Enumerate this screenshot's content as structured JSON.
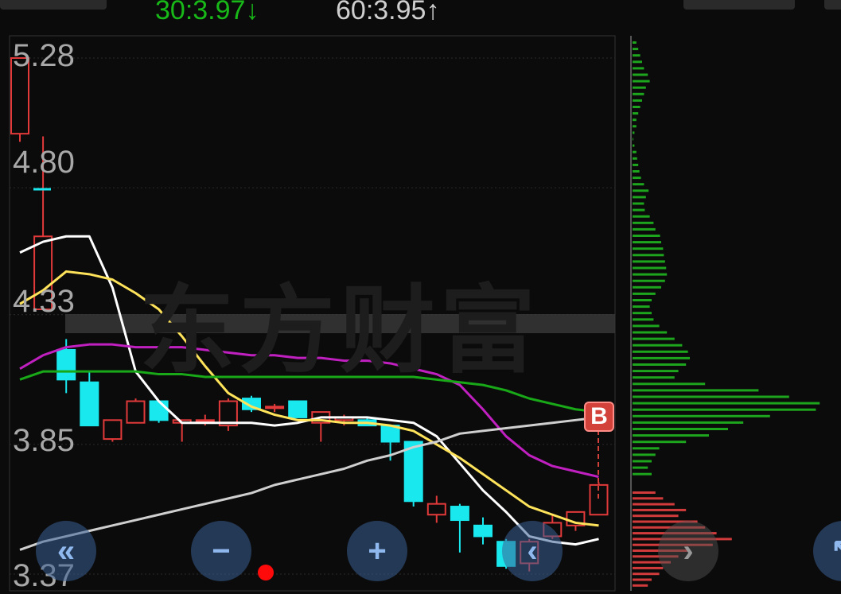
{
  "header": {
    "ma30": "30:3.97",
    "ma30_arrow": "↓",
    "ma60": "60:3.95",
    "ma60_arrow": "↑"
  },
  "watermark": "东方财富",
  "y_axis": {
    "labels": [
      "5.28",
      "4.80",
      "4.33",
      "3.85",
      "3.37"
    ],
    "values": [
      5.28,
      4.8,
      4.33,
      3.85,
      3.37
    ]
  },
  "badge": {
    "label": "B"
  },
  "controls": {
    "back": "«",
    "zoom_out": "−",
    "zoom_in": "+",
    "prev": "‹",
    "next": "›",
    "expand": "↖"
  },
  "colors": {
    "up": "#e23a3a",
    "down": "#19e8ee",
    "ma5": "#ffffff",
    "ma10": "#ffe35a",
    "ma20": "#c020c0",
    "ma30": "#18a818",
    "ma60": "#cfcfcf",
    "profile_up": "#d23b3b",
    "profile_down": "#1ea51e"
  },
  "chart_data": {
    "type": "candlestick",
    "ylim": [
      3.37,
      5.28
    ],
    "candles": [
      {
        "o": 5.0,
        "h": 5.28,
        "l": 4.97,
        "c": 5.28
      },
      {
        "o": 4.35,
        "h": 4.99,
        "l": 4.35,
        "c": 4.62
      },
      {
        "o": 4.2,
        "h": 4.24,
        "l": 4.04,
        "c": 4.09
      },
      {
        "o": 4.08,
        "h": 4.12,
        "l": 3.92,
        "c": 3.92
      },
      {
        "o": 3.87,
        "h": 3.94,
        "l": 3.86,
        "c": 3.94
      },
      {
        "o": 3.93,
        "h": 4.02,
        "l": 3.93,
        "c": 4.01
      },
      {
        "o": 4.01,
        "h": 4.01,
        "l": 3.93,
        "c": 3.94
      },
      {
        "o": 3.93,
        "h": 3.94,
        "l": 3.86,
        "c": 3.94
      },
      {
        "o": 3.94,
        "h": 3.96,
        "l": 3.92,
        "c": 3.94
      },
      {
        "o": 3.92,
        "h": 4.02,
        "l": 3.9,
        "c": 4.01
      },
      {
        "o": 4.02,
        "h": 4.03,
        "l": 3.97,
        "c": 3.98
      },
      {
        "o": 3.99,
        "h": 4.0,
        "l": 3.97,
        "c": 3.99
      },
      {
        "o": 4.01,
        "h": 4.01,
        "l": 3.95,
        "c": 3.95
      },
      {
        "o": 3.93,
        "h": 3.97,
        "l": 3.86,
        "c": 3.97
      },
      {
        "o": 3.94,
        "h": 3.96,
        "l": 3.92,
        "c": 3.95
      },
      {
        "o": 3.94,
        "h": 3.95,
        "l": 3.92,
        "c": 3.92
      },
      {
        "o": 3.92,
        "h": 3.92,
        "l": 3.79,
        "c": 3.86
      },
      {
        "o": 3.86,
        "h": 3.86,
        "l": 3.62,
        "c": 3.64
      },
      {
        "o": 3.59,
        "h": 3.66,
        "l": 3.56,
        "c": 3.63
      },
      {
        "o": 3.62,
        "h": 3.63,
        "l": 3.45,
        "c": 3.57
      },
      {
        "o": 3.55,
        "h": 3.58,
        "l": 3.48,
        "c": 3.51
      },
      {
        "o": 3.49,
        "h": 3.5,
        "l": 3.39,
        "c": 3.4
      },
      {
        "o": 3.41,
        "h": 3.5,
        "l": 3.38,
        "c": 3.49
      },
      {
        "o": 3.51,
        "h": 3.59,
        "l": 3.5,
        "c": 3.56
      },
      {
        "o": 3.55,
        "h": 3.6,
        "l": 3.53,
        "c": 3.6
      },
      {
        "o": 3.59,
        "h": 3.71,
        "l": 3.59,
        "c": 3.7
      }
    ],
    "ma_lines": [
      {
        "key": "ma5",
        "values": [
          4.56,
          4.6,
          4.62,
          4.62,
          4.43,
          4.12,
          4.01,
          3.93,
          3.93,
          3.93,
          3.93,
          3.92,
          3.93,
          3.95,
          3.95,
          3.95,
          3.94,
          3.93,
          3.88,
          3.78,
          3.68,
          3.6,
          3.51,
          3.49,
          3.48,
          3.5
        ]
      },
      {
        "key": "ma10",
        "values": [
          4.37,
          4.42,
          4.49,
          4.48,
          4.46,
          4.41,
          4.35,
          4.25,
          4.14,
          4.04,
          3.99,
          3.96,
          3.94,
          3.94,
          3.93,
          3.93,
          3.92,
          3.9,
          3.85,
          3.8,
          3.74,
          3.68,
          3.62,
          3.59,
          3.56,
          3.55
        ]
      },
      {
        "key": "ma20",
        "values": [
          4.13,
          4.18,
          4.21,
          4.22,
          4.22,
          4.21,
          4.21,
          4.21,
          4.2,
          4.19,
          4.18,
          4.18,
          4.17,
          4.17,
          4.16,
          4.16,
          4.15,
          4.13,
          4.11,
          4.07,
          3.98,
          3.88,
          3.81,
          3.77,
          3.75,
          3.73
        ]
      },
      {
        "key": "ma30",
        "values": [
          4.09,
          4.12,
          4.12,
          4.12,
          4.12,
          4.12,
          4.11,
          4.11,
          4.1,
          4.1,
          4.1,
          4.1,
          4.1,
          4.1,
          4.1,
          4.1,
          4.1,
          4.1,
          4.09,
          4.08,
          4.07,
          4.05,
          4.02,
          4.0,
          3.98,
          3.97
        ]
      },
      {
        "key": "ma60",
        "values": [
          3.46,
          3.49,
          3.51,
          3.53,
          3.55,
          3.57,
          3.59,
          3.61,
          3.63,
          3.65,
          3.67,
          3.7,
          3.72,
          3.74,
          3.76,
          3.79,
          3.81,
          3.84,
          3.86,
          3.89,
          3.9,
          3.91,
          3.92,
          3.93,
          3.94,
          3.95
        ]
      }
    ],
    "volume_profile": {
      "down": [
        0.1,
        0.15,
        0.2,
        0.25,
        0.3,
        0.4,
        0.45,
        0.35,
        0.3,
        0.25,
        0.2,
        0.15,
        0.1,
        0.1,
        0.05,
        0,
        0.05,
        0.1,
        0.12,
        0.15,
        0.18,
        0.22,
        0.3,
        0.42,
        0.35,
        0.3,
        0.32,
        0.45,
        0.55,
        0.6,
        0.72,
        0.75,
        0.8,
        0.82,
        0.85,
        0.88,
        0.9,
        0.85,
        0.75,
        0.6,
        0.5,
        0.45,
        0.5,
        0.55,
        0.7,
        0.9,
        1.1,
        1.3,
        1.45,
        1.5,
        1.4,
        1.2,
        1.1,
        1.9,
        3.3,
        4.1,
        4.9,
        4.8,
        3.6,
        2.9,
        2.5,
        2.0,
        1.4,
        0.7,
        0.6,
        0.5,
        0.4,
        0.5
      ],
      "up": [
        0.6,
        0.8,
        1.1,
        1.4,
        1.2,
        1.7,
        1.9,
        2.2,
        2.6,
        2.1,
        1.5,
        1.2,
        1.0,
        0.8,
        0.7,
        0.5,
        0.4
      ]
    }
  }
}
